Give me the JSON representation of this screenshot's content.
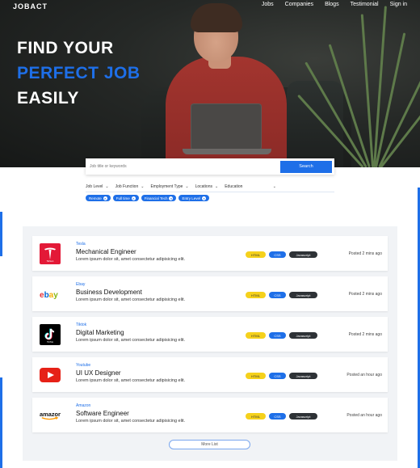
{
  "brand": {
    "logo": "JOBACT"
  },
  "nav": {
    "items": [
      "Jobs",
      "Companies",
      "Blogs",
      "Testimonial",
      "Sign in"
    ]
  },
  "hero": {
    "line1": "FIND YOUR",
    "line2": "PERFECT JOB",
    "line3": "EASILY"
  },
  "search": {
    "placeholder": "Job title or keywords",
    "button": "Search"
  },
  "filters": [
    "Job Level",
    "Job Function",
    "Employment Type",
    "Locations",
    "Education"
  ],
  "chips": [
    "Remote",
    "Full time",
    "Financial Tech",
    "Entry Level"
  ],
  "jobs": [
    {
      "company": "Tesla",
      "title": "Mechanical Engineer",
      "desc": "Lorem ipsum dolor sit, amet consectetur adipisicing elit.",
      "tags": [
        "HTML",
        "CSS",
        "Javascript"
      ],
      "posted": "Posted 2 mins ago",
      "logo": "tesla-logo"
    },
    {
      "company": "Ebay",
      "title": "Business Development",
      "desc": "Lorem ipsum dolor sit, amet consectetur adipisicing elit.",
      "tags": [
        "HTML",
        "CSS",
        "Javascript"
      ],
      "posted": "Posted 2 mins ago",
      "logo": "ebay-logo"
    },
    {
      "company": "Tiktok",
      "title": "Digital Marketing",
      "desc": "Lorem ipsum dolor sit, amet consectetur adipisicing elit.",
      "tags": [
        "HTML",
        "CSS",
        "Javascript"
      ],
      "posted": "Posted 2 mins ago",
      "logo": "tiktok-logo"
    },
    {
      "company": "Youtube",
      "title": "UI UX Designer",
      "desc": "Lorem ipsum dolor sit, amet consectetur adipisicing elit.",
      "tags": [
        "HTML",
        "CSS",
        "Javascript"
      ],
      "posted": "Posted an hour ago",
      "logo": "youtube-logo"
    },
    {
      "company": "Amazon",
      "title": "Software Engineer",
      "desc": "Lorem ipsum dolor sit, amet consectetur adipisicing elit.",
      "tags": [
        "HTML",
        "CSS",
        "Javascript"
      ],
      "posted": "Posted an hour ago",
      "logo": "amazon-logo"
    }
  ],
  "more_button": "More List",
  "colors": {
    "accent": "#1e6fe8",
    "html_tag": "#f5d11c",
    "js_tag": "#2e3236",
    "panel": "#f1f3f6"
  }
}
